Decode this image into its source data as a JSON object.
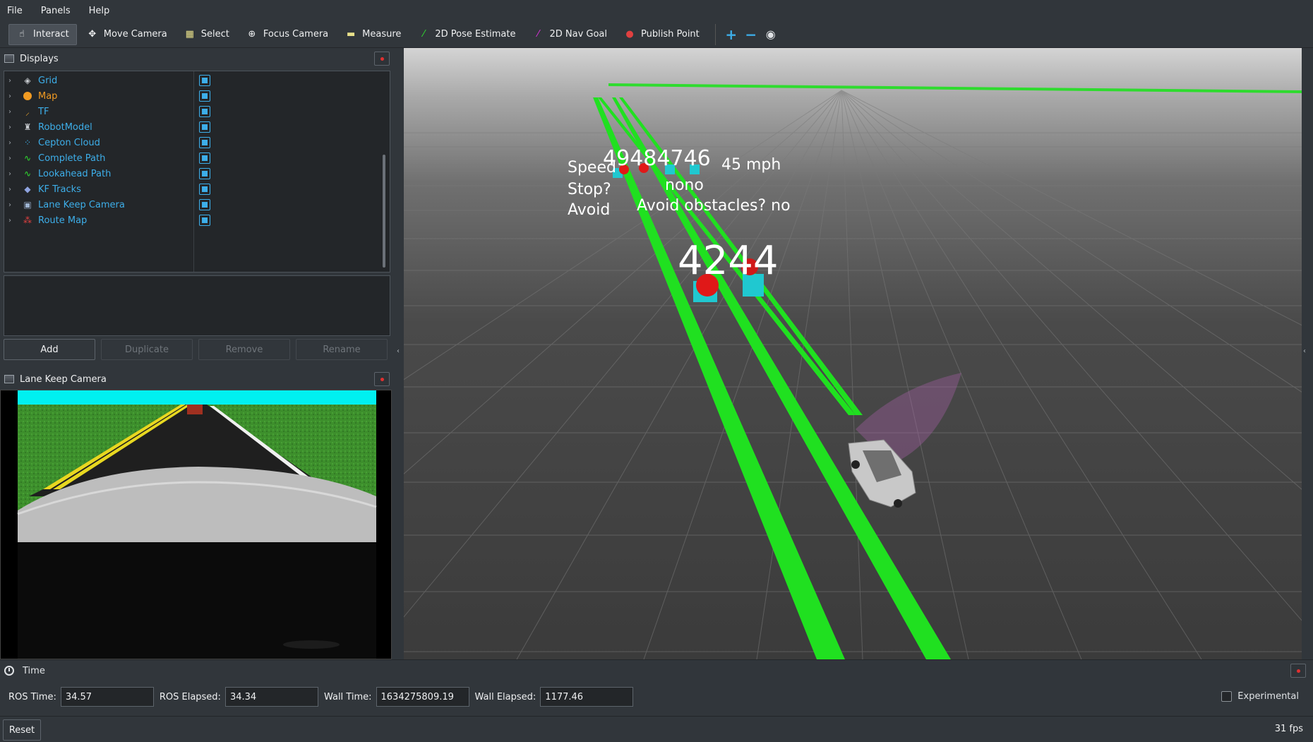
{
  "menu": {
    "items": [
      "File",
      "Panels",
      "Help"
    ]
  },
  "toolbar": {
    "tools": [
      {
        "label": "Interact",
        "icon": "hand-icon"
      },
      {
        "label": "Move Camera",
        "icon": "move-icon"
      },
      {
        "label": "Select",
        "icon": "select-icon"
      },
      {
        "label": "Focus Camera",
        "icon": "crosshair-icon"
      },
      {
        "label": "Measure",
        "icon": "ruler-icon"
      },
      {
        "label": "2D Pose Estimate",
        "icon": "green-arrow-icon"
      },
      {
        "label": "2D Nav Goal",
        "icon": "magenta-arrow-icon"
      },
      {
        "label": "Publish Point",
        "icon": "pin-icon"
      }
    ],
    "extra_icons": [
      "plus-icon",
      "minus-icon",
      "eye-icon"
    ]
  },
  "displays": {
    "title": "Displays",
    "items": [
      {
        "label": "Grid",
        "icon": "grid-icon",
        "checked": true
      },
      {
        "label": "Map",
        "icon": "warning-icon",
        "checked": true,
        "warn": true
      },
      {
        "label": "TF",
        "icon": "tf-icon",
        "checked": true
      },
      {
        "label": "RobotModel",
        "icon": "robot-icon",
        "checked": true
      },
      {
        "label": "Cepton Cloud",
        "icon": "pointcloud-icon",
        "checked": true
      },
      {
        "label": "Complete Path",
        "icon": "path-icon",
        "checked": true
      },
      {
        "label": "Lookahead Path",
        "icon": "path-icon",
        "checked": true
      },
      {
        "label": "KF Tracks",
        "icon": "marker-icon",
        "checked": true
      },
      {
        "label": "Lane Keep Camera",
        "icon": "image-icon",
        "checked": true
      },
      {
        "label": "Route Map",
        "icon": "markerarray-icon",
        "checked": true
      }
    ],
    "buttons": {
      "add": "Add",
      "duplicate": "Duplicate",
      "remove": "Remove",
      "rename": "Rename"
    }
  },
  "camera_panel": {
    "title": "Lane Keep Camera"
  },
  "viewport": {
    "big_number": "4244",
    "far_number": "49484746",
    "labels": {
      "speed": "Speed",
      "speed_tail": "45 mph",
      "stop": "Stop?",
      "stop_tail": "nono",
      "avoid": "Avoid",
      "avoid_tail": "Avoid obstacles? no"
    }
  },
  "time": {
    "title": "Time",
    "ros_time_label": "ROS Time:",
    "ros_time": "34.57",
    "ros_elapsed_label": "ROS Elapsed:",
    "ros_elapsed": "34.34",
    "wall_time_label": "Wall Time:",
    "wall_time": "1634275809.19",
    "wall_elapsed_label": "Wall Elapsed:",
    "wall_elapsed": "1177.46",
    "experimental": "Experimental"
  },
  "status": {
    "reset": "Reset",
    "fps": "31 fps"
  }
}
